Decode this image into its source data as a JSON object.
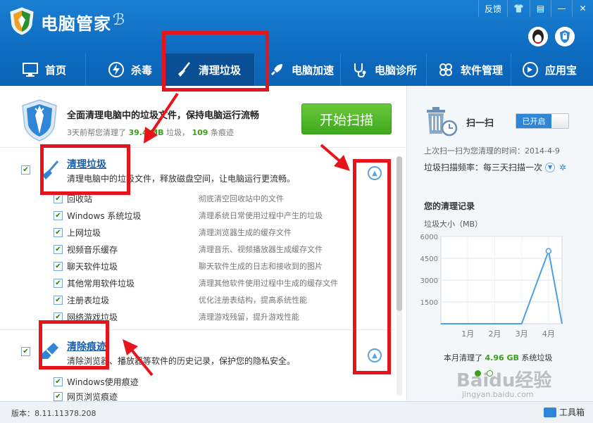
{
  "app": {
    "title": "电脑管家",
    "window_controls": {
      "feedback": "反馈",
      "skin": "👕",
      "menu": "▤",
      "minimize": "—",
      "close": "✕"
    }
  },
  "nav": {
    "items": [
      {
        "label": "首页",
        "icon": "monitor-icon"
      },
      {
        "label": "杀毒",
        "icon": "antivirus-icon"
      },
      {
        "label": "清理垃圾",
        "icon": "broom-icon",
        "active": true
      },
      {
        "label": "电脑加速",
        "icon": "rocket-icon"
      },
      {
        "label": "电脑诊所",
        "icon": "stethoscope-icon"
      },
      {
        "label": "软件管理",
        "icon": "apps-icon"
      },
      {
        "label": "应用宝",
        "icon": "appstore-icon"
      }
    ]
  },
  "summary": {
    "title": "全面清理电脑中的垃圾文件，保持电脑运行流畅",
    "sub_prefix": "3天前帮您清理了",
    "sub_size": "39.4",
    "sub_unit": "MB",
    "sub_mid": "垃圾，",
    "sub_count": "109",
    "sub_suffix": "条痕迹",
    "scan_button": "开始扫描"
  },
  "sections": [
    {
      "title": "清理垃圾",
      "desc": "清理电脑中的垃圾文件，释放磁盘空间，让电脑运行更流畅。",
      "items": [
        {
          "name": "回收站",
          "desc": "彻底清空回收站中的文件"
        },
        {
          "name": "Windows 系统垃圾",
          "desc": "清理系统日常使用过程中产生的垃圾"
        },
        {
          "name": "上网垃圾",
          "desc": "清理浏览器生成的缓存文件"
        },
        {
          "name": "视频音乐缓存",
          "desc": "清理音乐、视频播放器生成缓存文件"
        },
        {
          "name": "聊天软件垃圾",
          "desc": "聊天软件生成的日志和接收到的图片"
        },
        {
          "name": "其他常用软件垃圾",
          "desc": "清理其他软件使用过程中生成的缓存文件"
        },
        {
          "name": "注册表垃圾",
          "desc": "优化注册表结构，提高系统性能"
        },
        {
          "name": "网络游戏垃圾",
          "desc": "清理游戏残留，提升游戏性能"
        }
      ]
    },
    {
      "title": "清除痕迹",
      "desc": "清除浏览器、播放器等软件的历史记录，保护您的隐私安全。",
      "items": [
        {
          "name": "Windows使用痕迹",
          "desc": ""
        },
        {
          "name": "网页浏览痕迹",
          "desc": ""
        }
      ]
    }
  ],
  "right": {
    "sweep_label": "扫一扫",
    "toggle_label": "已开启",
    "last_time": "上次扫一扫为您清理的时间：2014-4-9",
    "freq": "垃圾扫描频率：每三天扫描一次",
    "record_title": "您的清理记录",
    "unit_label": "垃圾大小（MB）",
    "month_total_prefix": "本月清理了",
    "month_total_value": "4.96 GB",
    "month_total_suffix": "系统垃圾",
    "watermark": "Baidu经验",
    "watermark_sub": "jingyan.baidu.com"
  },
  "chart_data": {
    "type": "line",
    "categories": [
      "1月",
      "2月",
      "3月",
      "4月"
    ],
    "x": [
      0,
      0.5,
      1,
      1.5,
      2,
      2.5,
      3,
      3.5,
      4,
      4.5
    ],
    "values": [
      0,
      0,
      0,
      0,
      0,
      0,
      0,
      2500,
      5000,
      0
    ],
    "yticks": [
      1500,
      3000,
      4500,
      6000
    ],
    "ylim": [
      0,
      6000
    ],
    "ylabel": "垃圾大小（MB）",
    "color": "#4a9fe6"
  },
  "footer": {
    "version": "版本：8.11.11378.208",
    "toolbox": "工具箱"
  }
}
